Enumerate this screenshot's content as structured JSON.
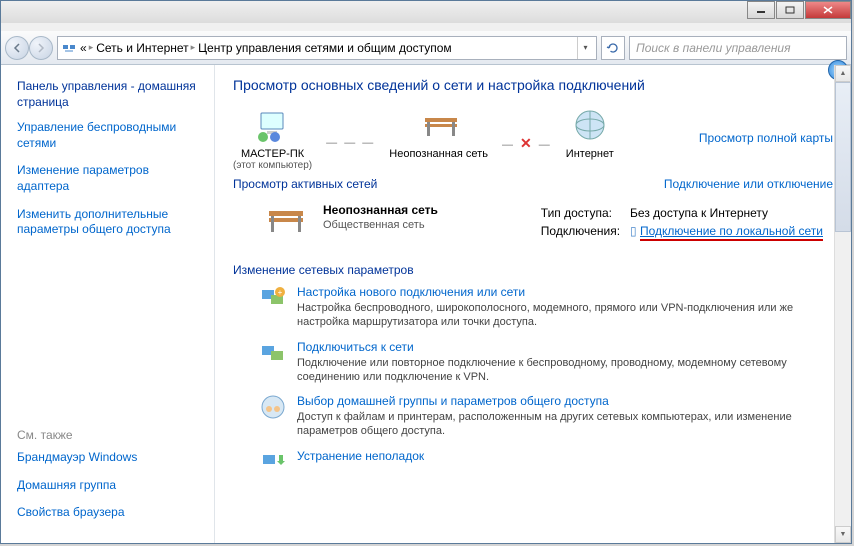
{
  "titlebar": {},
  "toolbar": {
    "breadcrumb": {
      "p0": "«",
      "p1": "Сеть и Интернет",
      "p2": "Центр управления сетями и общим доступом"
    },
    "search_placeholder": "Поиск в панели управления"
  },
  "sidebar": {
    "header": "Панель управления - домашняя страница",
    "links": {
      "l0": "Управление беспроводными сетями",
      "l1": "Изменение параметров адаптера",
      "l2": "Изменить дополнительные параметры общего доступа"
    },
    "see_also": "См. также",
    "bottom": {
      "b0": "Брандмауэр Windows",
      "b1": "Домашняя группа",
      "b2": "Свойства браузера"
    }
  },
  "main": {
    "title": "Просмотр основных сведений о сети и настройка подключений",
    "map": {
      "node0": {
        "label": "МАСТЕР-ПК",
        "sub": "(этот компьютер)"
      },
      "node1": {
        "label": "Неопознанная сеть"
      },
      "node2": {
        "label": "Интернет"
      },
      "full_map": "Просмотр полной карты"
    },
    "active": {
      "header": "Просмотр активных сетей",
      "toggle": "Подключение или отключение",
      "name": "Неопознанная сеть",
      "type": "Общественная сеть",
      "access_label": "Тип доступа:",
      "access_value": "Без доступа к Интернету",
      "conn_label": "Подключения:",
      "conn_link": "Подключение по локальной сети"
    },
    "settings_header": "Изменение сетевых параметров",
    "tasks": {
      "t0": {
        "title": "Настройка нового подключения или сети",
        "desc": "Настройка беспроводного, широкополосного, модемного, прямого или VPN-подключения или же настройка маршрутизатора или точки доступа."
      },
      "t1": {
        "title": "Подключиться к сети",
        "desc": "Подключение или повторное подключение к беспроводному, проводному, модемному сетевому соединению или подключение к VPN."
      },
      "t2": {
        "title": "Выбор домашней группы и параметров общего доступа",
        "desc": "Доступ к файлам и принтерам, расположенным на других сетевых компьютерах, или изменение параметров общего доступа."
      },
      "t3": {
        "title": "Устранение неполадок"
      }
    }
  }
}
